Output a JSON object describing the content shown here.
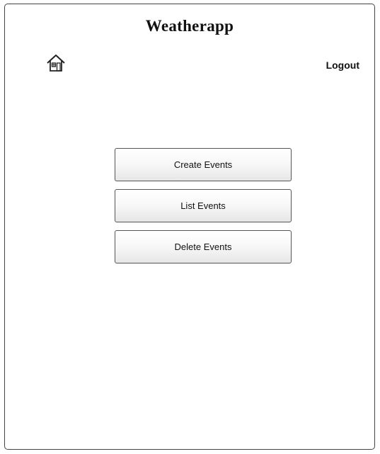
{
  "header": {
    "title": "Weatherapp",
    "home_icon": "home-icon",
    "logout_label": "Logout"
  },
  "menu": {
    "create_label": "Create Events",
    "list_label": "List Events",
    "delete_label": "Delete Events"
  }
}
